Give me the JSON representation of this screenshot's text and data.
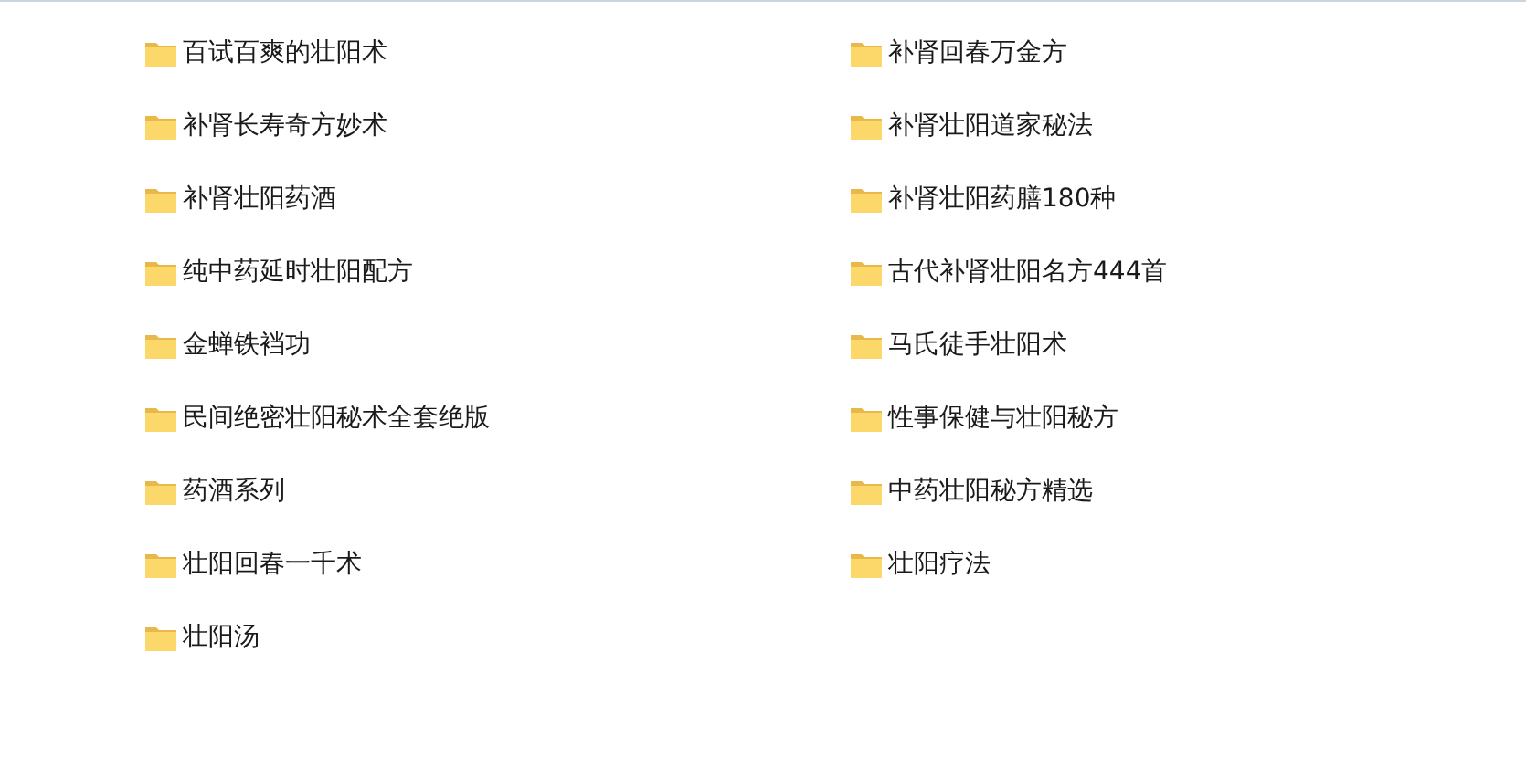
{
  "folders": [
    {
      "name": "百试百爽的壮阳术"
    },
    {
      "name": "补肾回春万金方"
    },
    {
      "name": "补肾长寿奇方妙术"
    },
    {
      "name": "补肾壮阳道家秘法"
    },
    {
      "name": "补肾壮阳药酒"
    },
    {
      "name": "补肾壮阳药膳180种"
    },
    {
      "name": "纯中药延时壮阳配方"
    },
    {
      "name": "古代补肾壮阳名方444首"
    },
    {
      "name": "金蝉铁裆功"
    },
    {
      "name": "马氏徒手壮阳术"
    },
    {
      "name": "民间绝密壮阳秘术全套绝版"
    },
    {
      "name": "性事保健与壮阳秘方"
    },
    {
      "name": "药酒系列"
    },
    {
      "name": "中药壮阳秘方精选"
    },
    {
      "name": "壮阳回春一千术"
    },
    {
      "name": "壮阳疗法"
    },
    {
      "name": "壮阳汤"
    }
  ]
}
